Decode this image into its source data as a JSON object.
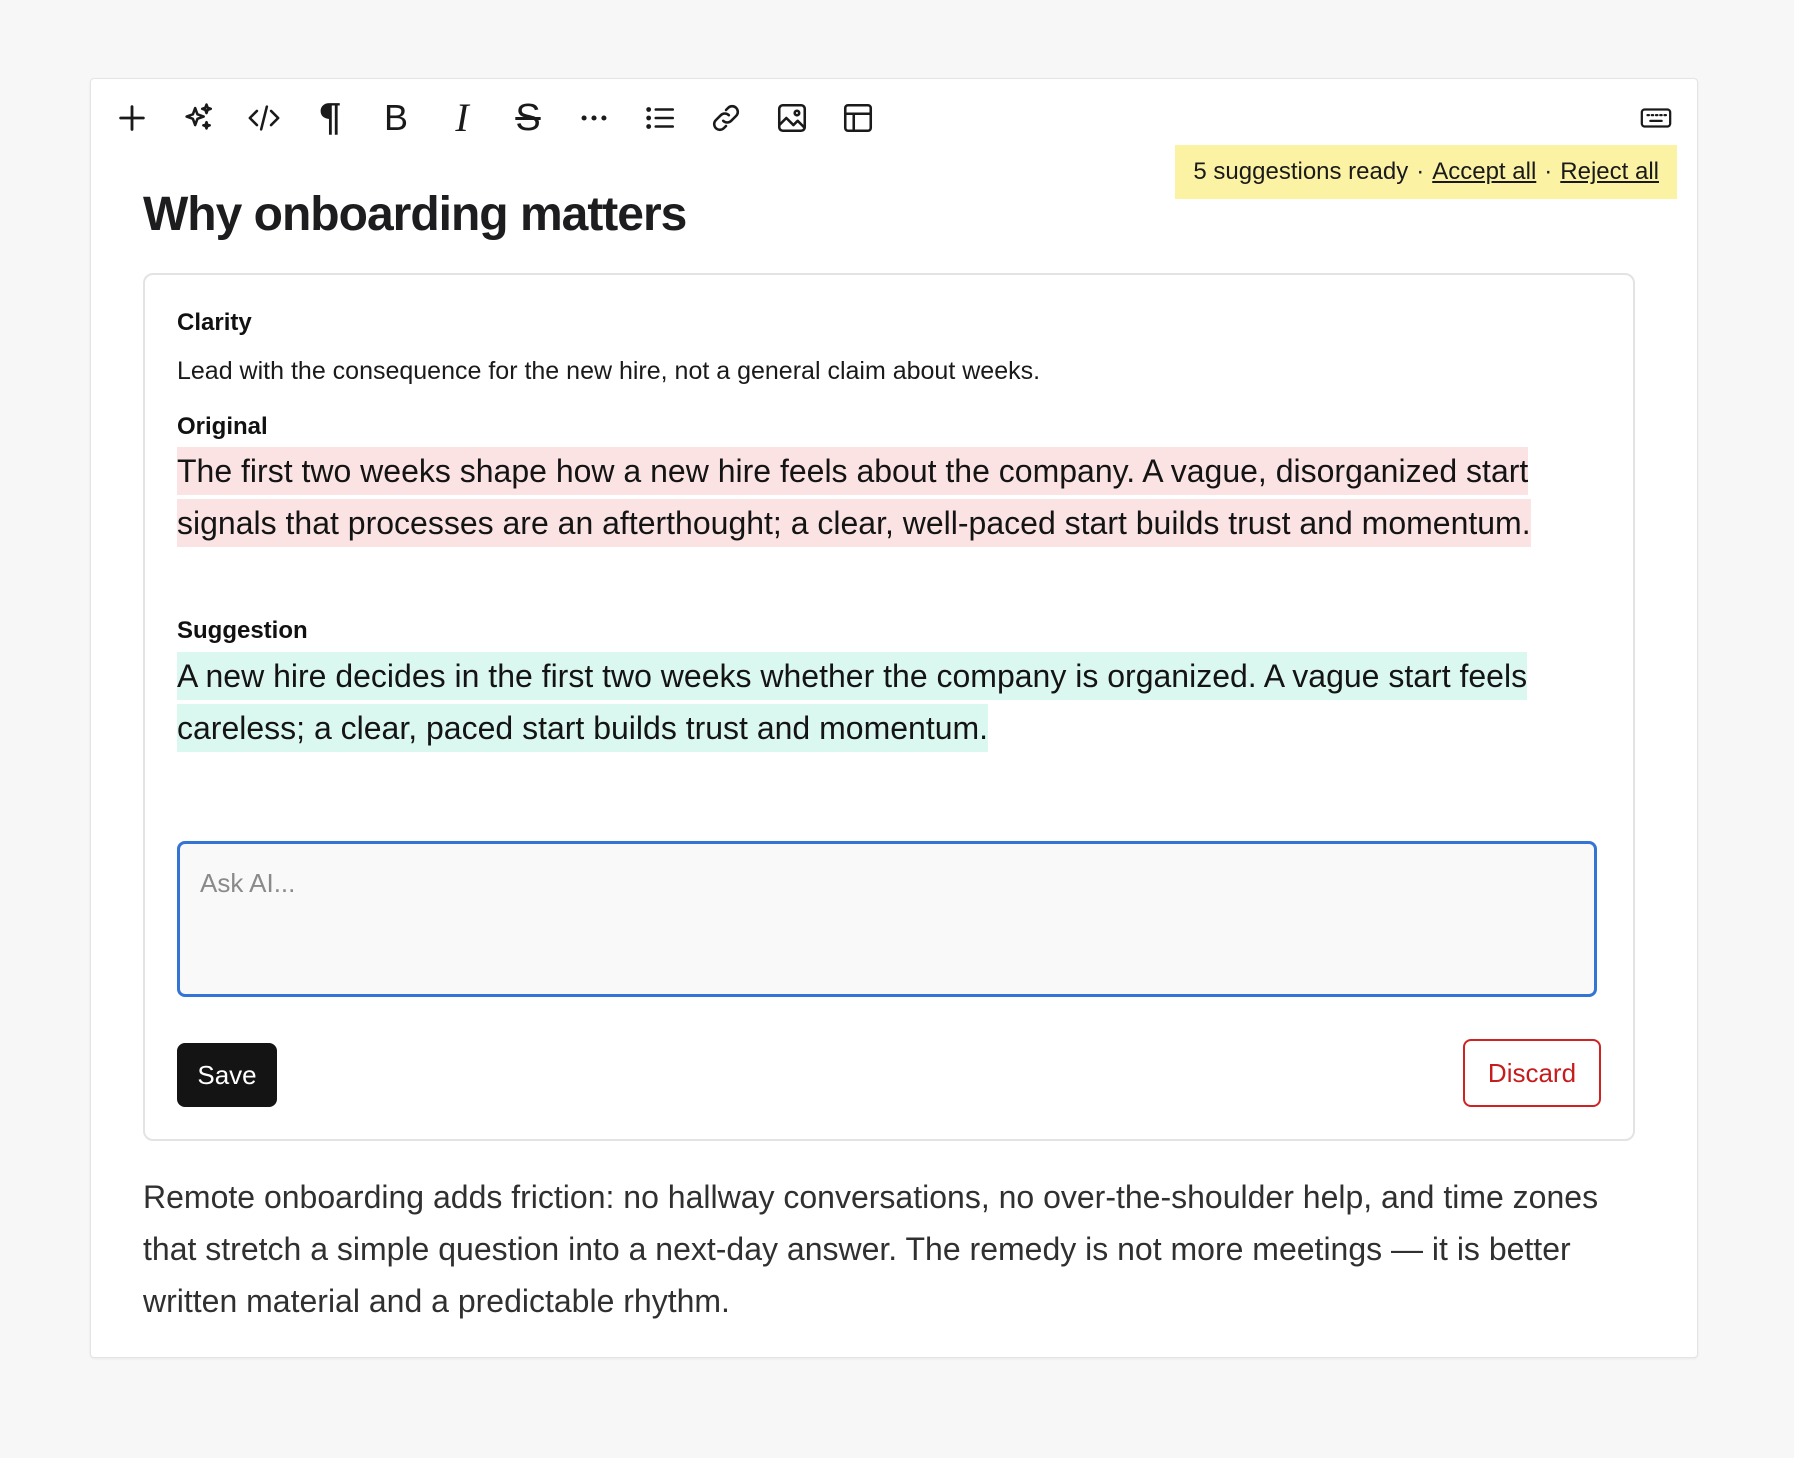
{
  "toolbar": {
    "icons": [
      "plus-icon",
      "sparkles-icon",
      "code-icon",
      "paragraph-icon",
      "bold-icon",
      "italic-icon",
      "strikethrough-icon",
      "more-icon",
      "list-icon",
      "link-icon",
      "image-icon",
      "table-icon",
      "keyboard-icon"
    ],
    "glyph_paragraph": "¶",
    "glyph_bold": "B",
    "glyph_italic": "I",
    "glyph_strike": "S"
  },
  "banner": {
    "status": "5 suggestions ready",
    "separator": "·",
    "accept_all": "Accept all",
    "reject_all": "Reject all"
  },
  "document": {
    "title": "Why onboarding matters",
    "paragraph": "Remote onboarding adds friction: no hallway conversations, no over-the-shoulder help, and time zones that stretch a simple question into a next-day answer. The remedy is not more meetings — it is better written material and a predictable rhythm."
  },
  "suggestion_card": {
    "category_label": "Clarity",
    "category_text": "Lead with the consequence for the new hire, not a general claim about weeks.",
    "original_label": "Original",
    "original_text": "The first two weeks shape how a new hire feels about the company. A vague, disorganized start signals that processes are an afterthought; a clear, well-paced start builds trust and momentum.",
    "suggestion_label": "Suggestion",
    "suggestion_text": "A new hire decides in the first two weeks whether the company is organized. A vague start feels careless; a clear, paced start builds trust and momentum.",
    "ask_placeholder": "Ask AI...",
    "ask_value": "",
    "save_label": "Save",
    "discard_label": "Discard"
  },
  "colors": {
    "banner_bg": "#fbf2a4",
    "original_highlight": "#fbe3e4",
    "suggestion_highlight": "#dbf8f0",
    "focus_border": "#3474d4",
    "discard_red": "#cf2222"
  }
}
